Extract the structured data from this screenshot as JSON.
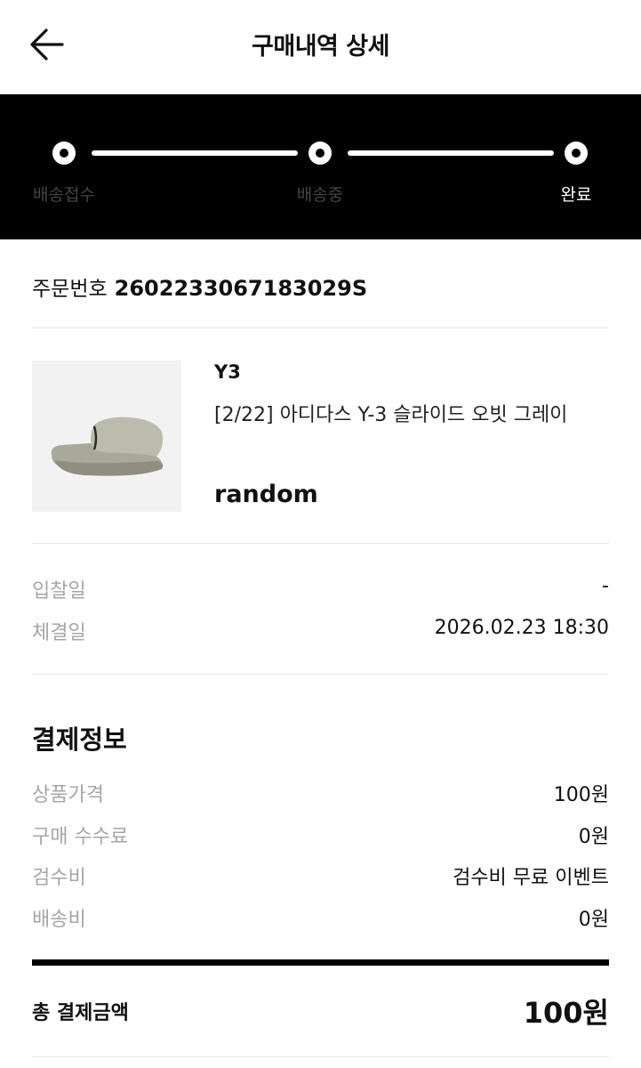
{
  "header": {
    "title": "구매내역 상세",
    "back_icon": "arrow-left-icon"
  },
  "progress": {
    "steps": [
      {
        "label": "배송접수",
        "active": false
      },
      {
        "label": "배송중",
        "active": false
      },
      {
        "label": "완료",
        "active": true
      }
    ]
  },
  "order": {
    "label": "주문번호",
    "number": "2602233067183029S"
  },
  "product": {
    "brand": "Y3",
    "name": "[2/22] 아디다스 Y-3 슬라이드 오빗 그레이",
    "option": "random",
    "image_icon": "slide-sandal-image"
  },
  "dates": [
    {
      "label": "입찰일",
      "value": "-"
    },
    {
      "label": "체결일",
      "value": "2026.02.23 18:30"
    }
  ],
  "payment": {
    "title": "결제정보",
    "rows": [
      {
        "label": "상품가격",
        "value": "100원"
      },
      {
        "label": "구매 수수료",
        "value": "0원"
      },
      {
        "label": "검수비",
        "value": "검수비 무료 이벤트"
      },
      {
        "label": "배송비",
        "value": "0원"
      }
    ],
    "total_label": "총 결제금액",
    "total_value": "100원"
  }
}
